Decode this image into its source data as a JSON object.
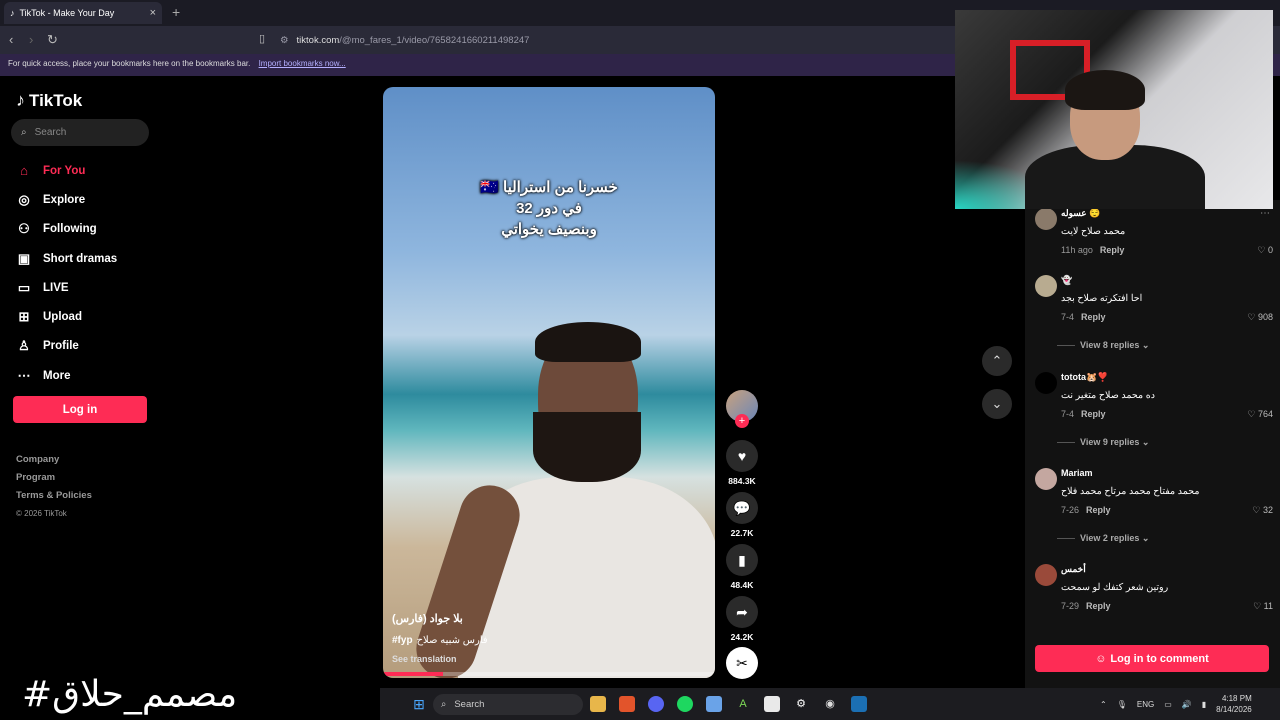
{
  "browser": {
    "tab_title": "TikTok - Make Your Day",
    "new_tab": "+",
    "tab_close": "×",
    "url_domain": "tiktok.com",
    "url_path": "/@mo_fares_1/video/7658241660211498247",
    "bookmarks_text": "For quick access, place your bookmarks here on the bookmarks bar.",
    "import_link": "Import bookmarks now..."
  },
  "sidebar": {
    "logo": "TikTok",
    "search_placeholder": "Search",
    "nav": [
      {
        "label": "For You",
        "icon": "home-icon"
      },
      {
        "label": "Explore",
        "icon": "compass-icon"
      },
      {
        "label": "Following",
        "icon": "following-icon"
      },
      {
        "label": "Short dramas",
        "icon": "drama-icon"
      },
      {
        "label": "LIVE",
        "icon": "live-icon"
      },
      {
        "label": "Upload",
        "icon": "upload-icon"
      },
      {
        "label": "Profile",
        "icon": "profile-icon"
      },
      {
        "label": "More",
        "icon": "more-icon"
      }
    ],
    "login": "Log in",
    "footer": [
      "Company",
      "Program",
      "Terms & Policies"
    ],
    "copyright": "© 2026 TikTok"
  },
  "video": {
    "overlay_line1": "خسرنا من استراليا 🇦🇺",
    "overlay_line2": "في دور 32",
    "overlay_line3": "وبنصيف يخواتي",
    "author": "بلا جواد (فارس)",
    "hashtag": "#fyp",
    "caption": "فارس شبيه صلاح",
    "see_translation": "See translation",
    "progress": 0.18
  },
  "actions": {
    "likes": "884.3K",
    "comments": "22.7K",
    "saves": "48.4K",
    "shares": "24.2K"
  },
  "comments": [
    {
      "user": "عسوله 😌",
      "text": "محمد صلاح لايت",
      "time": "11h ago",
      "reply": "Reply",
      "likes": "0",
      "color": "#8a7a6a"
    },
    {
      "user": "👻",
      "text": "احا افتكرته صلاح بجد",
      "time": "7-4",
      "reply": "Reply",
      "likes": "908",
      "color": "#b8ab90",
      "view": "View 8 replies"
    },
    {
      "user": "totota🐹❣️",
      "text": "ده محمد صلاح متغير نت",
      "time": "7-4",
      "reply": "Reply",
      "likes": "764",
      "color": "#000",
      "view": "View 9 replies"
    },
    {
      "user": "Mariam",
      "text": "محمد مفتاح محمد مرتاح محمد فلاح",
      "time": "7-26",
      "reply": "Reply",
      "likes": "32",
      "color": "#c4a7a0",
      "view": "View 2 replies"
    },
    {
      "user": "أخمس",
      "text": "روتين شعر كتفك لو سمحت",
      "time": "7-29",
      "reply": "Reply",
      "likes": "11",
      "color": "#9a4a3a"
    }
  ],
  "comment_login": "Log in to comment",
  "overlay_hashtag": "#مصمم_حلاق",
  "taskbar": {
    "search": "Search",
    "lang": "ENG",
    "time": "4:18 PM",
    "date": "8/14/2026"
  },
  "colors": {
    "accent": "#fe2c55",
    "background": "#000000",
    "panel": "#121212"
  }
}
